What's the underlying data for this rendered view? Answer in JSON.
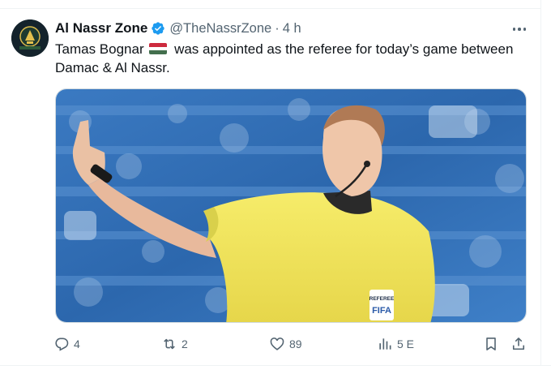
{
  "tweet": {
    "author_name": "Al Nassr Zone",
    "handle": "@TheNassrZone",
    "separator": "·",
    "time": "4 h",
    "text_part1": "Tamas Bognar ",
    "flag": "hungary-flag",
    "text_part2": " was appointed as the referee for today’s game between Damac & Al Nassr.",
    "media_badge_line1": "REFEREE",
    "media_badge_line2": "FIFA"
  },
  "actions": {
    "replies": "4",
    "reposts": "2",
    "likes": "89",
    "views": "5 E"
  },
  "colors": {
    "text": "#0f1419",
    "secondary": "#536471",
    "verified": "#1d9bf0",
    "jersey": "#f3e558",
    "stadium_blue": "#2f6fb5"
  },
  "icons": [
    "verified-badge-icon",
    "more-icon",
    "reply-icon",
    "repost-icon",
    "like-icon",
    "views-icon",
    "bookmark-icon",
    "share-icon"
  ]
}
